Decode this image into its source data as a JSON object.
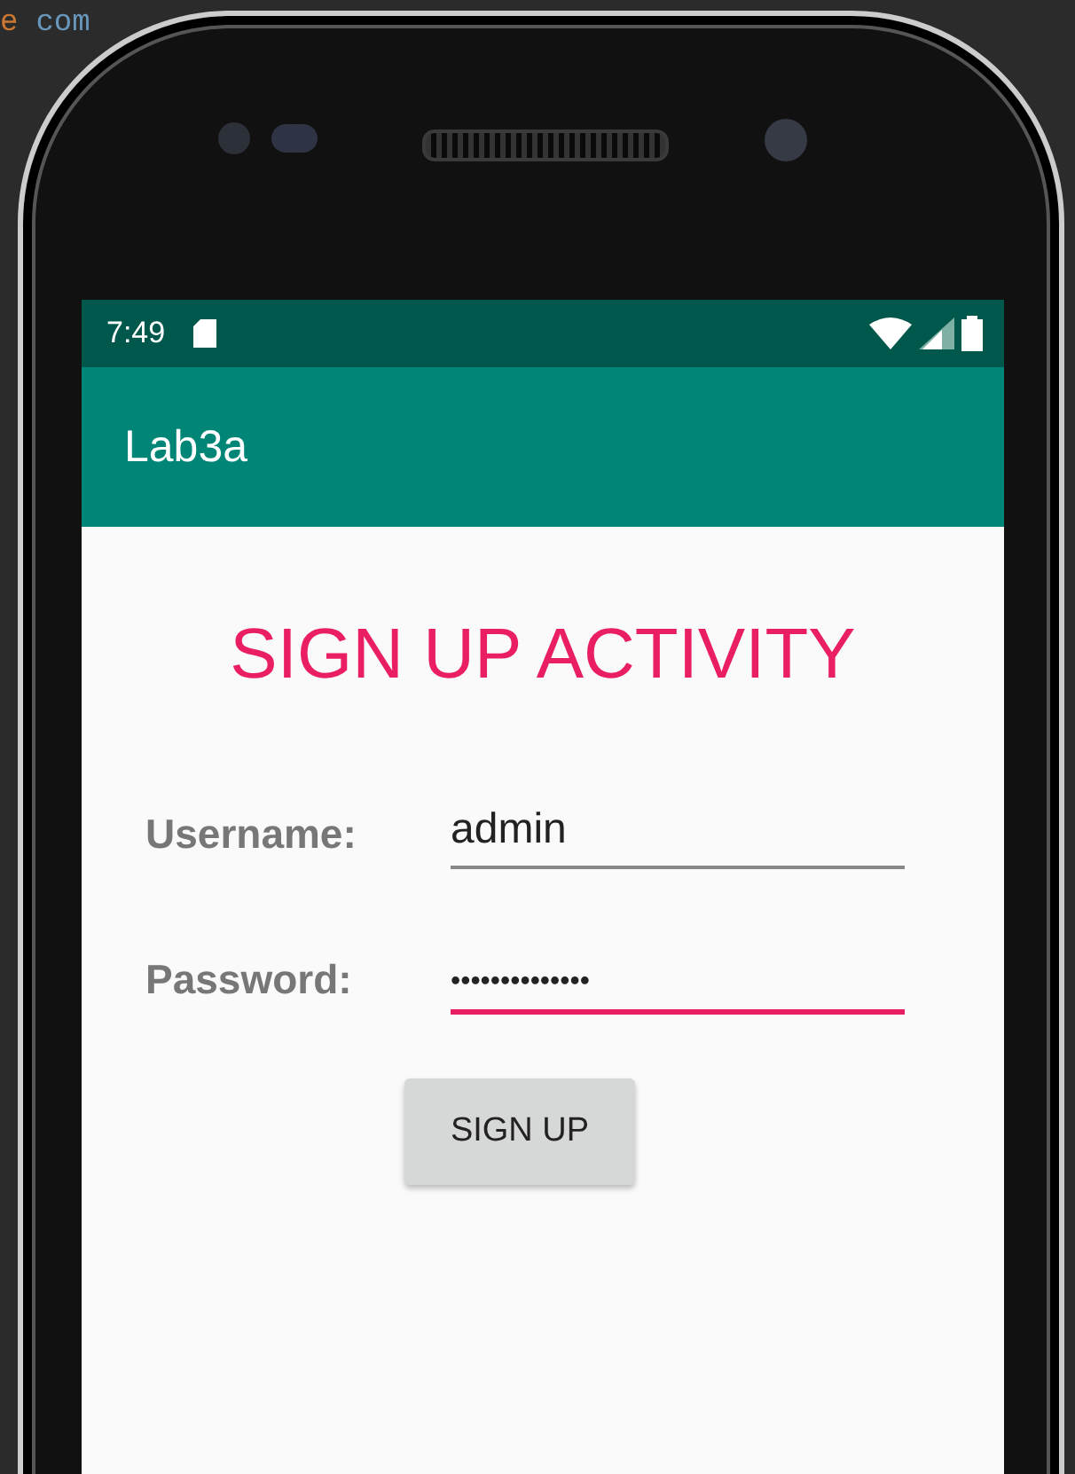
{
  "editor_text": [
    {
      "text": "e",
      "kind": "keyword"
    },
    {
      "text": "com",
      "kind": "identifier"
    }
  ],
  "status_bar": {
    "time": "7:49"
  },
  "app_bar": {
    "title": "Lab3a"
  },
  "heading": "SIGN UP ACTIVITY",
  "fields": [
    {
      "label": "Username:",
      "value": "admin",
      "kind": "text",
      "focused": false
    },
    {
      "label": "Password:",
      "value": "••••••••••••••",
      "kind": "password",
      "focused": true
    }
  ],
  "button": "SIGN UP"
}
